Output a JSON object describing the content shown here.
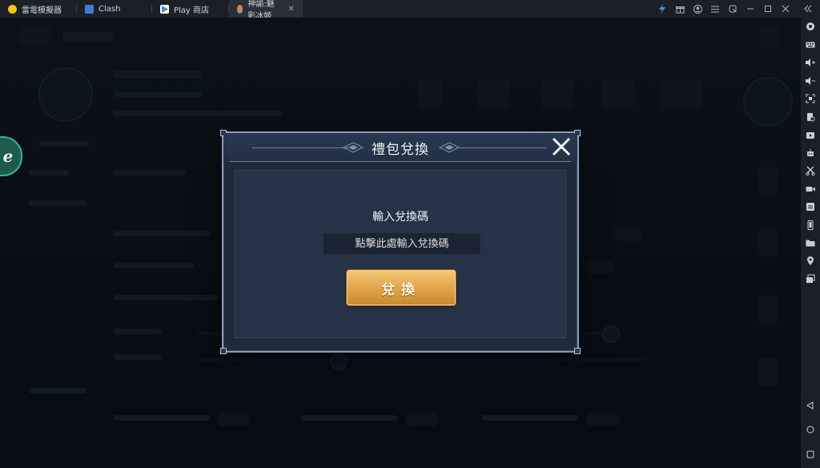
{
  "titlebar": {
    "tabs": [
      {
        "label": "雷電模擬器",
        "icon_color": "#f5c518",
        "icon": "ldplayer-logo-icon",
        "active": false
      },
      {
        "label": "Clash",
        "icon_color": "#3f7bd9",
        "icon": "clash-app-icon",
        "active": false
      },
      {
        "label": "Play 商店",
        "icon_color": "#34a853",
        "icon": "play-store-icon",
        "active": false
      },
      {
        "label": "神諭:魅影冰姬",
        "icon_color": "#c08a6b",
        "icon": "game-app-icon",
        "active": true
      }
    ],
    "controls": [
      "boost-icon",
      "gift-icon",
      "account-icon",
      "menu-icon",
      "restore-icon",
      "minimize-icon",
      "maximize-icon",
      "close-icon",
      "collapse-sidebar-icon"
    ]
  },
  "sidebar": {
    "tools": [
      "settings-icon",
      "keyboard-icon",
      "volume-up-icon",
      "volume-down-icon",
      "screenshot-icon",
      "shake-icon",
      "apk-install-icon",
      "robot-icon",
      "scissors-icon",
      "record-icon",
      "sync-icon",
      "rotate-icon",
      "folder-icon",
      "location-icon",
      "multi-instance-icon"
    ],
    "nav": [
      "back-icon",
      "home-icon",
      "recent-apps-icon"
    ]
  },
  "modal": {
    "title": "禮包兌換",
    "prompt": "輸入兌換碼",
    "input_placeholder": "點擊此處輸入兌換碼",
    "redeem_label": "兌換",
    "colors": {
      "button": "#e0a347",
      "panel": "#1f2a3b",
      "border": "#8a9bb3"
    }
  },
  "game": {
    "side_logo_glyph": "ℯ"
  }
}
